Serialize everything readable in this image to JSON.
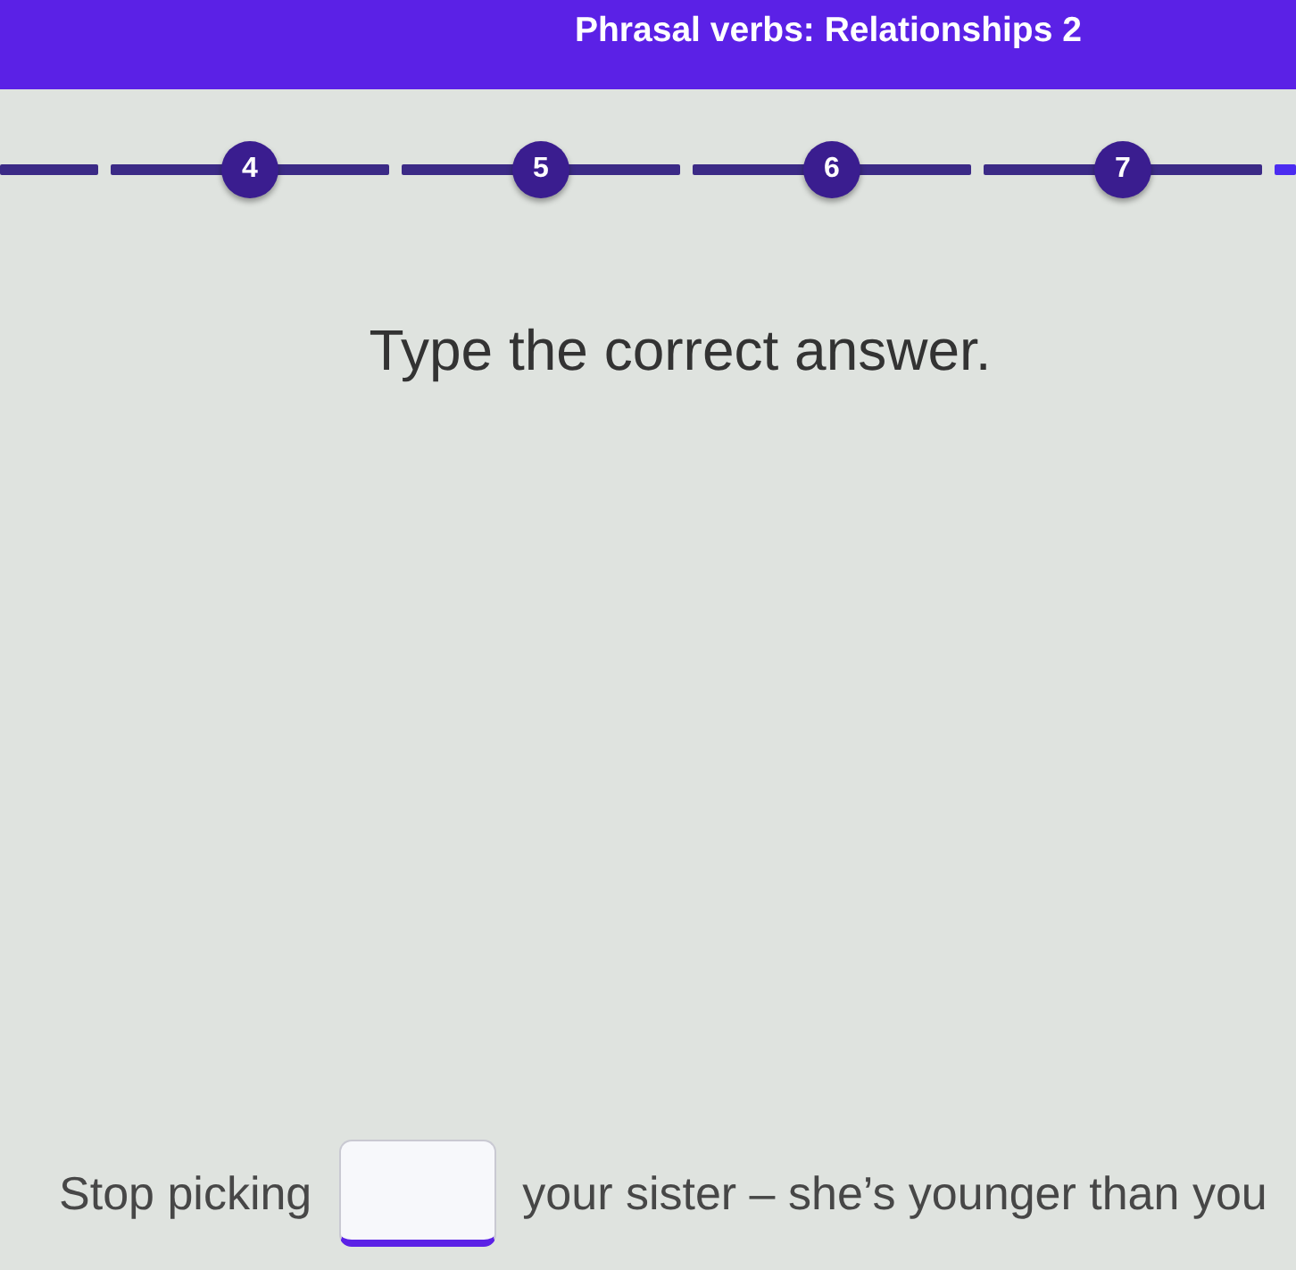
{
  "header": {
    "title": "Phrasal verbs: Relationships 2"
  },
  "progress": {
    "steps": [
      {
        "label": "4"
      },
      {
        "label": "5"
      },
      {
        "label": "6"
      },
      {
        "label": "7"
      }
    ]
  },
  "instruction": "Type the correct answer.",
  "question": {
    "parts": [
      {
        "kind": "text",
        "text": "Stop picking"
      },
      {
        "kind": "blank"
      },
      {
        "kind": "text",
        "text": "your sister – she’s younger than you"
      }
    ]
  }
}
